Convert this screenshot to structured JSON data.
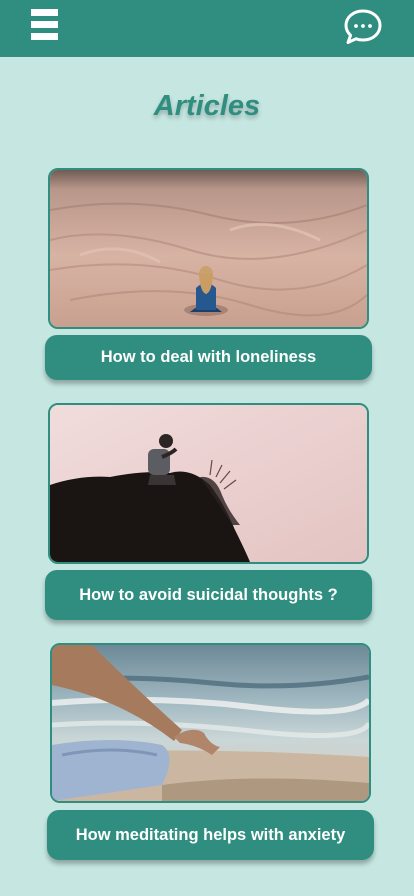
{
  "header": {
    "menu_icon": "hamburger-menu-icon",
    "chat_icon": "chat-bubble-icon",
    "bar_color": "#2f8e7f"
  },
  "page": {
    "title": "Articles",
    "background": "#c5e6e1"
  },
  "articles": [
    {
      "title": "How to deal with loneliness",
      "image": "person sitting alone in desert dunes"
    },
    {
      "title": "How to avoid suicidal thoughts ?",
      "image": "man sitting on a cliff edge at dusk"
    },
    {
      "title": "How meditating helps with anxiety",
      "image": "meditation pose by the sea"
    }
  ]
}
